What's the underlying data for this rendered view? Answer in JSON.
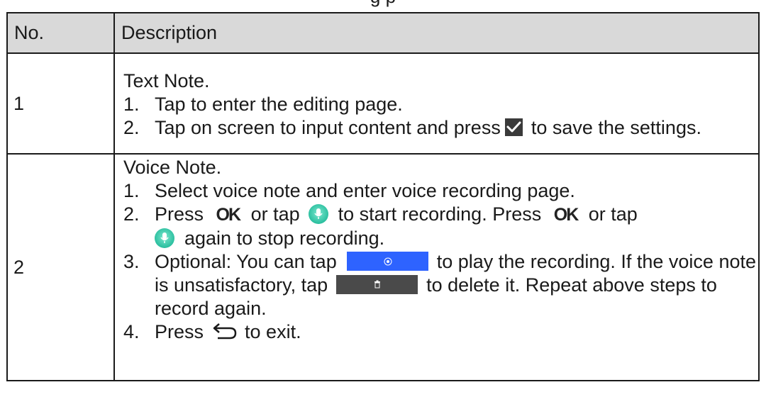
{
  "caption_fragment": "g p",
  "table": {
    "headers": [
      "No.",
      "Description"
    ],
    "rows": [
      {
        "no": "1",
        "title": "Text Note.",
        "steps": [
          {
            "n": "1.",
            "text": "Tap to enter the editing page."
          },
          {
            "n": "2.",
            "before": "Tap on screen to input content and press",
            "icon": "check-icon",
            "after": "to save the settings."
          }
        ]
      },
      {
        "no": "2",
        "title": "Voice Note.",
        "steps": [
          {
            "n": "1.",
            "text": "Select voice note and enter voice recording page."
          },
          {
            "n": "2.",
            "p1": "Press",
            "ok1": "OK",
            "p2": "or tap",
            "icon1": "mic-icon",
            "p3": "to start recording. Press",
            "ok2": "OK",
            "p4": "or tap",
            "icon2": "mic-icon",
            "p5": "again to stop recording."
          },
          {
            "n": "3.",
            "p1": "Optional: You can tap",
            "button1": "play-button",
            "p2": "to play the recording. If the voice note is unsatisfactory, tap",
            "button2": "delete-button",
            "p3": "to delete it. Repeat above steps to record again."
          },
          {
            "n": "4.",
            "p1": "Press",
            "icon": "back-icon",
            "p2": "to exit."
          }
        ]
      }
    ]
  },
  "colors": {
    "header_bg": "#d9d9d9",
    "play_button": "#2e63ff",
    "delete_button": "#4a4a4a",
    "mic": "#2bbf9f"
  }
}
